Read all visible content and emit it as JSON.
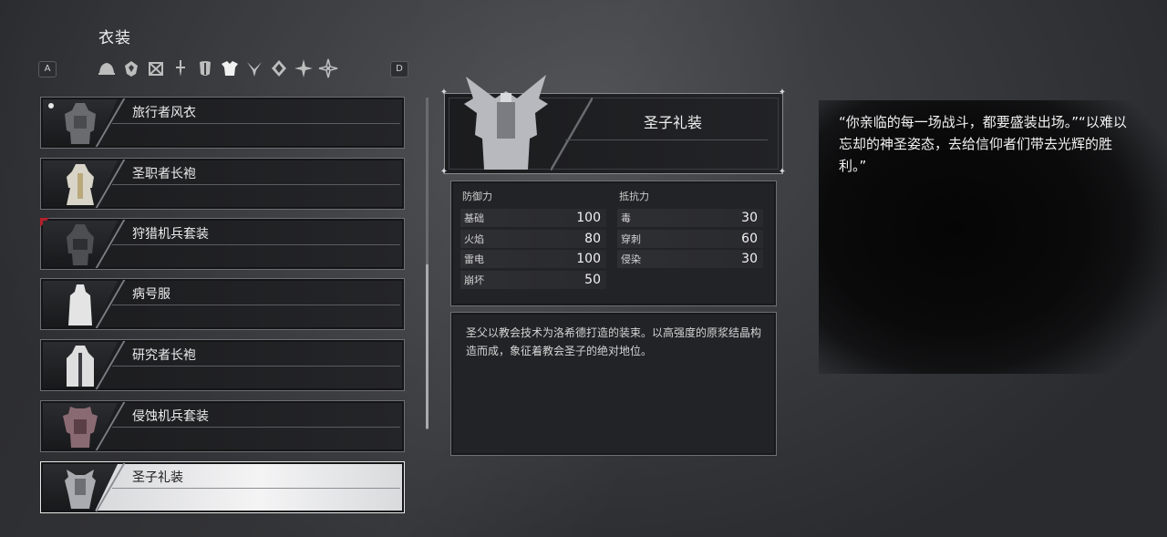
{
  "screen_title": "衣装",
  "key_hints": {
    "left": "A",
    "right": "D"
  },
  "category_icons": [
    "helmet-icon",
    "gem-icon",
    "box-icon",
    "sword-icon",
    "mask-icon",
    "armor-icon",
    "claw-icon",
    "rune-icon",
    "star-icon",
    "shuriken-icon"
  ],
  "outfits": [
    {
      "name": "旅行者风衣",
      "new_dot": true,
      "red_tag": false,
      "selected": false
    },
    {
      "name": "圣职者长袍",
      "new_dot": false,
      "red_tag": false,
      "selected": false
    },
    {
      "name": "狩猎机兵套装",
      "new_dot": false,
      "red_tag": true,
      "selected": false
    },
    {
      "name": "病号服",
      "new_dot": false,
      "red_tag": false,
      "selected": false
    },
    {
      "name": "研究者长袍",
      "new_dot": false,
      "red_tag": false,
      "selected": false
    },
    {
      "name": "侵蚀机兵套装",
      "new_dot": false,
      "red_tag": false,
      "selected": false
    },
    {
      "name": "圣子礼装",
      "new_dot": false,
      "red_tag": false,
      "selected": true
    }
  ],
  "detail": {
    "name": "圣子礼装",
    "defense": {
      "heading": "防御力",
      "rows": [
        {
          "label": "基础",
          "value": "100"
        },
        {
          "label": "火焰",
          "value": "80"
        },
        {
          "label": "雷电",
          "value": "100"
        },
        {
          "label": "崩坏",
          "value": "50"
        }
      ]
    },
    "resistance": {
      "heading": "抵抗力",
      "rows": [
        {
          "label": "毒",
          "value": "30"
        },
        {
          "label": "穿刺",
          "value": "60"
        },
        {
          "label": "侵染",
          "value": "30"
        }
      ]
    },
    "description": "圣父以教会技术为洛希德打造的装束。以高强度的原浆结晶构造而成，象征着教会圣子的绝对地位。"
  },
  "quote": "“你亲临的每一场战斗，都要盛装出场。”“以难以忘却的神圣姿态，去给信仰者们带去光辉的胜利。”",
  "colors": {
    "selected_bg": "#f4f4f5",
    "red_tag": "#b3202a",
    "panel_bg": "#222326"
  }
}
